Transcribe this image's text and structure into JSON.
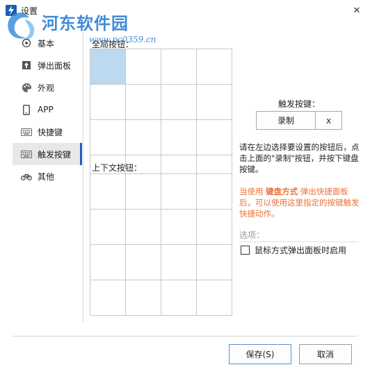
{
  "window": {
    "title": "设置",
    "close_glyph": "✕"
  },
  "watermark": {
    "brand": "河东软件园",
    "url": "www.pc0359.cn"
  },
  "sidebar": {
    "items": [
      {
        "label": "基本",
        "icon": "settings-icon"
      },
      {
        "label": "弹出面板",
        "icon": "popup-panel-icon"
      },
      {
        "label": "外观",
        "icon": "palette-icon"
      },
      {
        "label": "APP",
        "icon": "phone-icon"
      },
      {
        "label": "快捷键",
        "icon": "keyboard-icon"
      },
      {
        "label": "触发按键",
        "icon": "keyboard-icon",
        "active": true
      },
      {
        "label": "其他",
        "icon": "bicycle-icon"
      }
    ]
  },
  "global_buttons": {
    "title": "全局按钮：",
    "rows": 4,
    "cols": 4,
    "selected_index": 0
  },
  "context_buttons": {
    "title": "上下文按钮：",
    "rows": 4,
    "cols": 4
  },
  "trigger": {
    "label": "触发按键：",
    "record_label": "录制",
    "clear_label": "x"
  },
  "instructions": "请在左边选择要设置的按钮后，点击上面的\"录制\"按钮，并按下键盘按键。",
  "tip": {
    "prefix": "当使用 ",
    "highlight": "键盘方式",
    "suffix": " 弹出快捷面板后，可以使用这里指定的按键触发快捷动作。"
  },
  "options": {
    "label": "选项：",
    "checkbox_label": "鼠标方式弹出面板时启用",
    "checked": false
  },
  "footer": {
    "save_label": "保存(S)",
    "cancel_label": "取消"
  },
  "colors": {
    "accent": "#1e5fbf",
    "selected_cell": "#bcd9ef",
    "tip_text": "#e8733a",
    "watermark": "#2b7fd2"
  }
}
